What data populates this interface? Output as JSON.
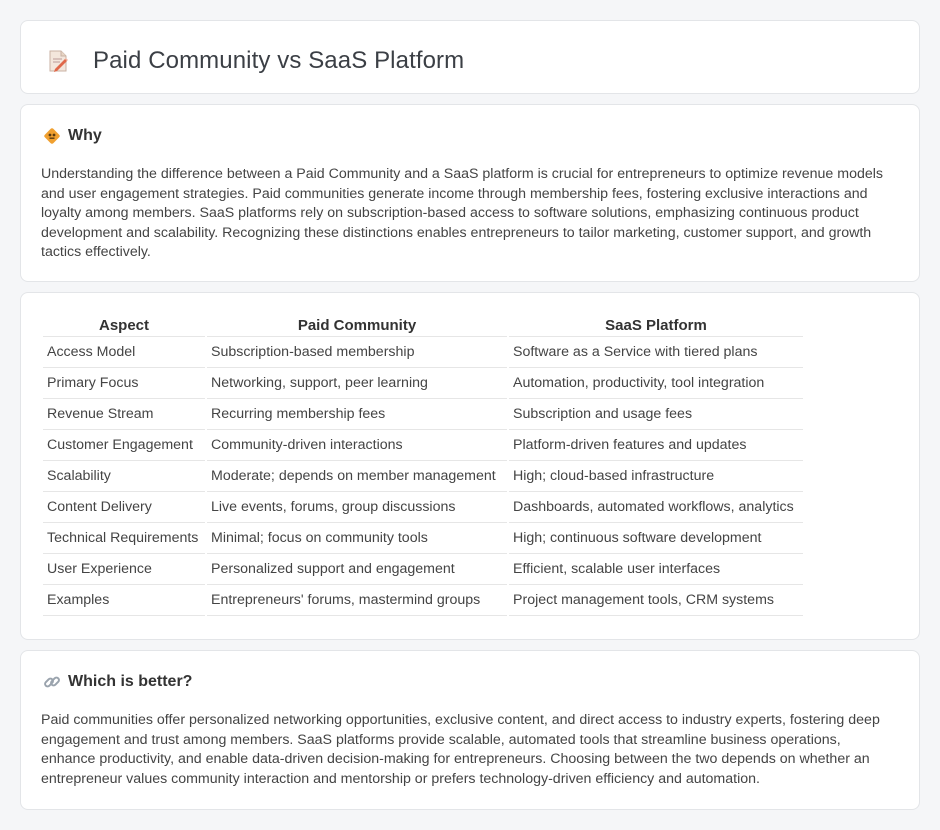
{
  "header": {
    "title": "Paid Community vs SaaS Platform",
    "icon": "document-edit-icon"
  },
  "why": {
    "heading": "Why",
    "icon": "diamond-warning-icon",
    "text": "Understanding the difference between a Paid Community and a SaaS platform is crucial for entrepreneurs to optimize revenue models and user engagement strategies. Paid communities generate income through membership fees, fostering exclusive interactions and loyalty among members. SaaS platforms rely on subscription-based access to software solutions, emphasizing continuous product development and scalability. Recognizing these distinctions enables entrepreneurs to tailor marketing, customer support, and growth tactics effectively."
  },
  "table": {
    "headers": [
      "Aspect",
      "Paid Community",
      "SaaS Platform"
    ],
    "rows": [
      [
        "Access Model",
        "Subscription-based membership",
        "Software as a Service with tiered plans"
      ],
      [
        "Primary Focus",
        "Networking, support, peer learning",
        "Automation, productivity, tool integration"
      ],
      [
        "Revenue Stream",
        "Recurring membership fees",
        "Subscription and usage fees"
      ],
      [
        "Customer Engagement",
        "Community-driven interactions",
        "Platform-driven features and updates"
      ],
      [
        "Scalability",
        "Moderate; depends on member management",
        "High; cloud-based infrastructure"
      ],
      [
        "Content Delivery",
        "Live events, forums, group discussions",
        "Dashboards, automated workflows, analytics"
      ],
      [
        "Technical Requirements",
        "Minimal; focus on community tools",
        "High; continuous software development"
      ],
      [
        "User Experience",
        "Personalized support and engagement",
        "Efficient, scalable user interfaces"
      ],
      [
        "Examples",
        "Entrepreneurs' forums, mastermind groups",
        "Project management tools, CRM systems"
      ]
    ]
  },
  "better": {
    "heading": "Which is better?",
    "icon": "link-icon",
    "text": "Paid communities offer personalized networking opportunities, exclusive content, and direct access to industry experts, fostering deep engagement and trust among members. SaaS platforms provide scalable, automated tools that streamline business operations, enhance productivity, and enable data-driven decision-making for entrepreneurs. Choosing between the two depends on whether an entrepreneur values community interaction and mentorship or prefers technology-driven efficiency and automation."
  },
  "colors": {
    "background": "#f5f6f8",
    "card": "#ffffff",
    "border": "#e3e5e8",
    "accent": "#f0a030"
  }
}
